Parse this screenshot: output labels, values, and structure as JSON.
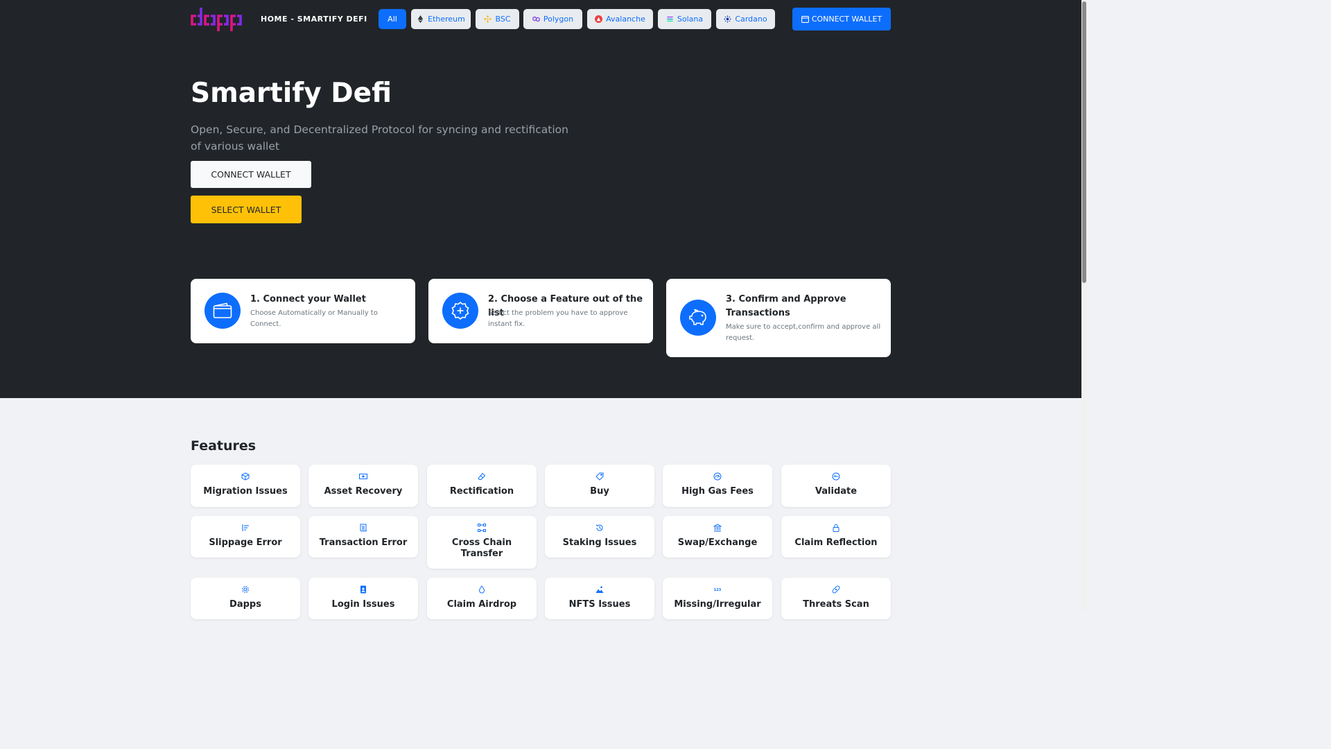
{
  "nav": {
    "home_link": "HOME - SMARTIFY DEFI",
    "chains": [
      {
        "label": "All",
        "icon": "grid-icon"
      },
      {
        "label": "Ethereum",
        "icon": "ethereum-icon"
      },
      {
        "label": "BSC",
        "icon": "bnb-icon"
      },
      {
        "label": "Polygon",
        "icon": "polygon-icon"
      },
      {
        "label": "Avalanche",
        "icon": "avalanche-icon"
      },
      {
        "label": "Solana",
        "icon": "solana-icon"
      },
      {
        "label": "Cardano",
        "icon": "cardano-icon"
      }
    ],
    "connect_label": "CONNECT WALLET"
  },
  "hero": {
    "title": "Smartify Defi",
    "subtitle": "Open, Secure, and Decentralized Protocol for syncing and rectification of various wallet",
    "connect_label": "CONNECT WALLET",
    "select_label": "SELECT WALLET"
  },
  "steps": [
    {
      "title": "1. Connect your Wallet",
      "desc": "Choose Automatically or Manually to Connect.",
      "icon": "wallet-icon"
    },
    {
      "title": "2. Choose a Feature out of the list",
      "desc": "Select the problem you have to approve instant fix.",
      "icon": "plus-badge-icon"
    },
    {
      "title": "3. Confirm and Approve Transactions",
      "desc": "Make sure to accept,confirm and approve all request.",
      "icon": "piggy-bank-icon"
    }
  ],
  "features": {
    "title": "Features",
    "items": [
      {
        "label": "Migration Issues",
        "icon": "box-icon"
      },
      {
        "label": "Asset Recovery",
        "icon": "cash-icon"
      },
      {
        "label": "Rectification",
        "icon": "eraser-icon"
      },
      {
        "label": "Buy",
        "icon": "tag-icon"
      },
      {
        "label": "High Gas Fees",
        "icon": "gauge-icon"
      },
      {
        "label": "Validate",
        "icon": "speedometer-icon"
      },
      {
        "label": "Slippage Error",
        "icon": "sort-bars-icon"
      },
      {
        "label": "Transaction Error",
        "icon": "receipt-icon"
      },
      {
        "label": "Cross Chain Transfer",
        "icon": "nodes-icon"
      },
      {
        "label": "Staking Issues",
        "icon": "history-icon"
      },
      {
        "label": "Swap/Exchange",
        "icon": "bank-icon"
      },
      {
        "label": "Claim Reflection",
        "icon": "lock-icon"
      },
      {
        "label": "Dapps",
        "icon": "gear-icon"
      },
      {
        "label": "Login Issues",
        "icon": "person-badge-icon"
      },
      {
        "label": "Claim Airdrop",
        "icon": "droplet-icon"
      },
      {
        "label": "NFTS Issues",
        "icon": "image-icon"
      },
      {
        "label": "Missing/Irregular",
        "icon": "numbers-123-icon"
      },
      {
        "label": "Threats Scan",
        "icon": "bandaid-icon"
      }
    ]
  },
  "colors": {
    "hero_bg": "#212529",
    "primary": "#0d6efd",
    "warning": "#ffc107",
    "light": "#f8f9fa",
    "page_bg": "#f0f2f5",
    "logo_gradient_start": "#e2147a",
    "logo_gradient_end": "#7b2cf0"
  }
}
